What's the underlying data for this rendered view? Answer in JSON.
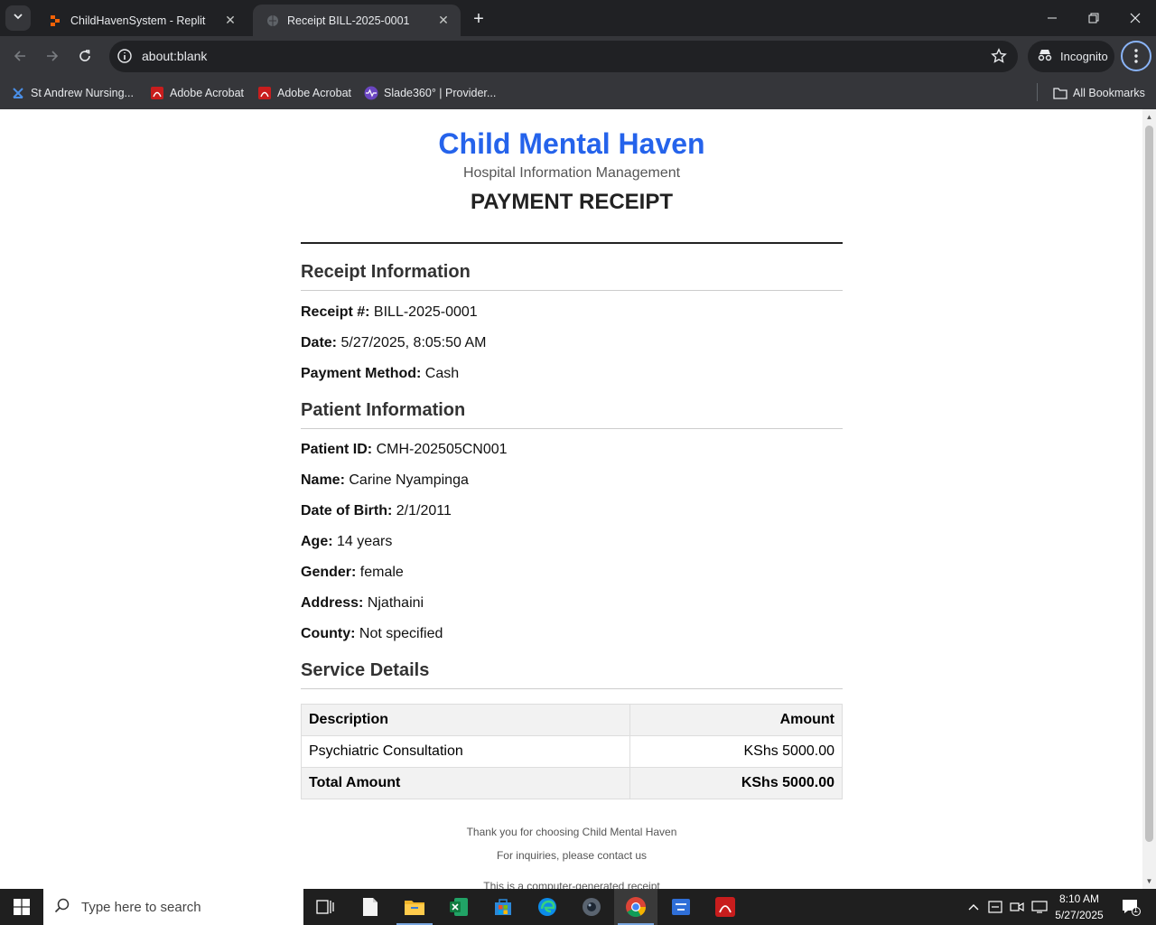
{
  "browser": {
    "tabs": [
      {
        "title": "ChildHavenSystem - Replit",
        "active": false
      },
      {
        "title": "Receipt BILL-2025-0001",
        "active": true
      }
    ],
    "url": "about:blank",
    "incognito_label": "Incognito",
    "bookmarks": [
      {
        "label": "St Andrew Nursing..."
      },
      {
        "label": "Adobe Acrobat"
      },
      {
        "label": "Adobe Acrobat"
      },
      {
        "label": "Slade360° | Provider..."
      }
    ],
    "all_bookmarks_label": "All Bookmarks"
  },
  "receipt": {
    "hospital_name": "Child Mental Haven",
    "subtitle": "Hospital Information Management",
    "title": "PAYMENT RECEIPT",
    "receipt_info": {
      "heading": "Receipt Information",
      "fields": [
        {
          "label": "Receipt #:",
          "value": "BILL-2025-0001"
        },
        {
          "label": "Date:",
          "value": "5/27/2025, 8:05:50 AM"
        },
        {
          "label": "Payment Method:",
          "value": "Cash"
        }
      ]
    },
    "patient_info": {
      "heading": "Patient Information",
      "fields": [
        {
          "label": "Patient ID:",
          "value": "CMH-202505CN001"
        },
        {
          "label": "Name:",
          "value": "Carine Nyampinga"
        },
        {
          "label": "Date of Birth:",
          "value": "2/1/2011"
        },
        {
          "label": "Age:",
          "value": "14 years"
        },
        {
          "label": "Gender:",
          "value": "female"
        },
        {
          "label": "Address:",
          "value": "Njathaini"
        },
        {
          "label": "County:",
          "value": "Not specified"
        }
      ]
    },
    "service_details": {
      "heading": "Service Details",
      "columns": [
        "Description",
        "Amount"
      ],
      "rows": [
        {
          "description": "Psychiatric Consultation",
          "amount": "KShs 5000.00"
        }
      ],
      "total_label": "Total Amount",
      "total_amount": "KShs 5000.00"
    },
    "footer": [
      "Thank you for choosing Child Mental Haven",
      "For inquiries, please contact us",
      "This is a computer-generated receipt"
    ]
  },
  "taskbar": {
    "search_placeholder": "Type here to search",
    "time": "8:10 AM",
    "date": "5/27/2025",
    "notification_count": "1"
  },
  "colors": {
    "brand_blue": "#2563eb",
    "browser_dark": "#202124",
    "browser_toolbar": "#35363a"
  }
}
